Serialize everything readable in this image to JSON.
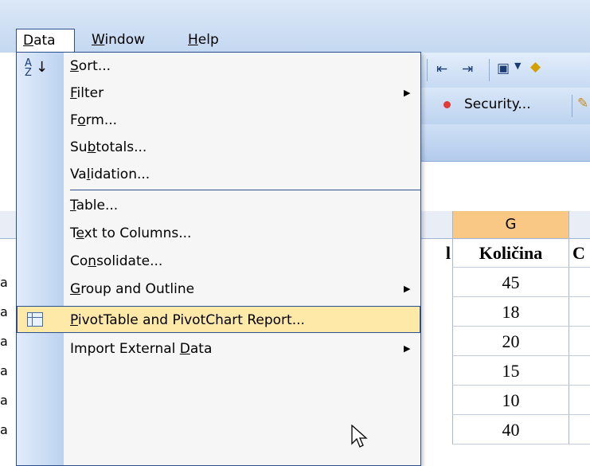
{
  "menubar": {
    "items": [
      {
        "label": "Data",
        "accel": "D"
      },
      {
        "label": "Window",
        "accel": "W"
      },
      {
        "label": "Help",
        "accel": "H"
      }
    ]
  },
  "toolbar": {
    "security_label": "Security..."
  },
  "data_menu": {
    "items": [
      {
        "pre": "",
        "accel": "S",
        "post": "ort...",
        "submenu": false
      },
      {
        "pre": "",
        "accel": "F",
        "post": "ilter",
        "submenu": true
      },
      {
        "pre": "F",
        "accel": "o",
        "post": "rm...",
        "submenu": false
      },
      {
        "pre": "Su",
        "accel": "b",
        "post": "totals...",
        "submenu": false
      },
      {
        "pre": "Va",
        "accel": "l",
        "post": "idation...",
        "submenu": false
      },
      {
        "pre": "",
        "accel": "T",
        "post": "able...",
        "submenu": false
      },
      {
        "pre": "T",
        "accel": "e",
        "post": "xt to Columns...",
        "submenu": false
      },
      {
        "pre": "Co",
        "accel": "n",
        "post": "solidate...",
        "submenu": false
      },
      {
        "pre": "",
        "accel": "G",
        "post": "roup and Outline",
        "submenu": true
      },
      {
        "pre": "",
        "accel": "P",
        "post": "ivotTable and PivotChart Report...",
        "submenu": false,
        "highlighted": true
      },
      {
        "pre": "Import External ",
        "accel": "D",
        "post": "ata",
        "submenu": true
      }
    ]
  },
  "sheet": {
    "column_header": "G",
    "header_cell": "Količina",
    "partial_f_header": "l",
    "partial_h_header": "C",
    "row_fragment": "a",
    "values": [
      "45",
      "18",
      "20",
      "15",
      "10",
      "40"
    ]
  }
}
